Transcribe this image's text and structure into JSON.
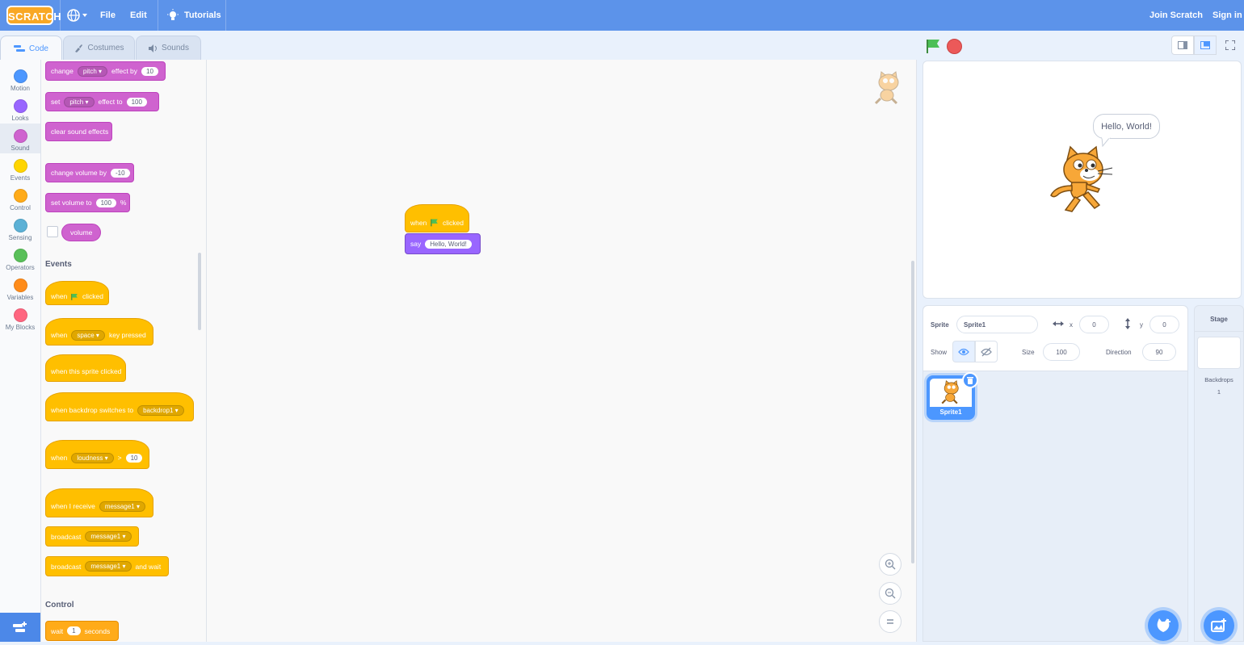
{
  "menu": {
    "logo": "SCRATCH",
    "file": "File",
    "edit": "Edit",
    "tutorials": "Tutorials",
    "join": "Join Scratch",
    "signin": "Sign in"
  },
  "tabs": {
    "code": "Code",
    "costumes": "Costumes",
    "sounds": "Sounds"
  },
  "categories": [
    {
      "label": "Motion",
      "color": "#4c97ff"
    },
    {
      "label": "Looks",
      "color": "#9966ff"
    },
    {
      "label": "Sound",
      "color": "#cf63cf"
    },
    {
      "label": "Events",
      "color": "#ffd500"
    },
    {
      "label": "Control",
      "color": "#ffab19"
    },
    {
      "label": "Sensing",
      "color": "#5cb1d6"
    },
    {
      "label": "Operators",
      "color": "#59c059"
    },
    {
      "label": "Variables",
      "color": "#ff8c1a"
    },
    {
      "label": "My Blocks",
      "color": "#ff6680"
    }
  ],
  "palette": {
    "change_effect": {
      "a": "change",
      "dd": "pitch",
      "b": "effect by",
      "v": "10"
    },
    "set_effect": {
      "a": "set",
      "dd": "pitch",
      "b": "effect to",
      "v": "100"
    },
    "clear_effects": "clear sound effects",
    "change_volume": {
      "a": "change volume by",
      "v": "-10"
    },
    "set_volume": {
      "a": "set volume to",
      "v": "100",
      "b": "%"
    },
    "volume_reporter": "volume",
    "events_header": "Events",
    "flag_clicked": {
      "a": "when",
      "b": "clicked"
    },
    "key_pressed": {
      "a": "when",
      "dd": "space",
      "b": "key pressed"
    },
    "sprite_clicked": "when this sprite clicked",
    "backdrop_switch": {
      "a": "when backdrop switches to",
      "dd": "backdrop1"
    },
    "loudness": {
      "a": "when",
      "dd": "loudness",
      "op": ">",
      "v": "10"
    },
    "receive": {
      "a": "when I receive",
      "dd": "message1"
    },
    "broadcast": {
      "a": "broadcast",
      "dd": "message1"
    },
    "broadcast_wait": {
      "a": "broadcast",
      "dd": "message1",
      "b": "and wait"
    },
    "control_header": "Control",
    "wait": {
      "a": "wait",
      "v": "1",
      "b": "seconds"
    }
  },
  "script": {
    "hat": {
      "a": "when",
      "b": "clicked"
    },
    "say": {
      "a": "say",
      "v": "Hello, World!"
    }
  },
  "stage": {
    "bubble": "Hello, World!"
  },
  "sprite_info": {
    "sprite_label": "Sprite",
    "sprite_name": "Sprite1",
    "x_label": "x",
    "x": "0",
    "y_label": "y",
    "y": "0",
    "show_label": "Show",
    "size_label": "Size",
    "size": "100",
    "direction_label": "Direction",
    "direction": "90"
  },
  "sprites": [
    {
      "name": "Sprite1",
      "selected": true
    }
  ],
  "stage_pane": {
    "title": "Stage",
    "backdrops_label": "Backdrops",
    "backdrops_count": "1"
  }
}
